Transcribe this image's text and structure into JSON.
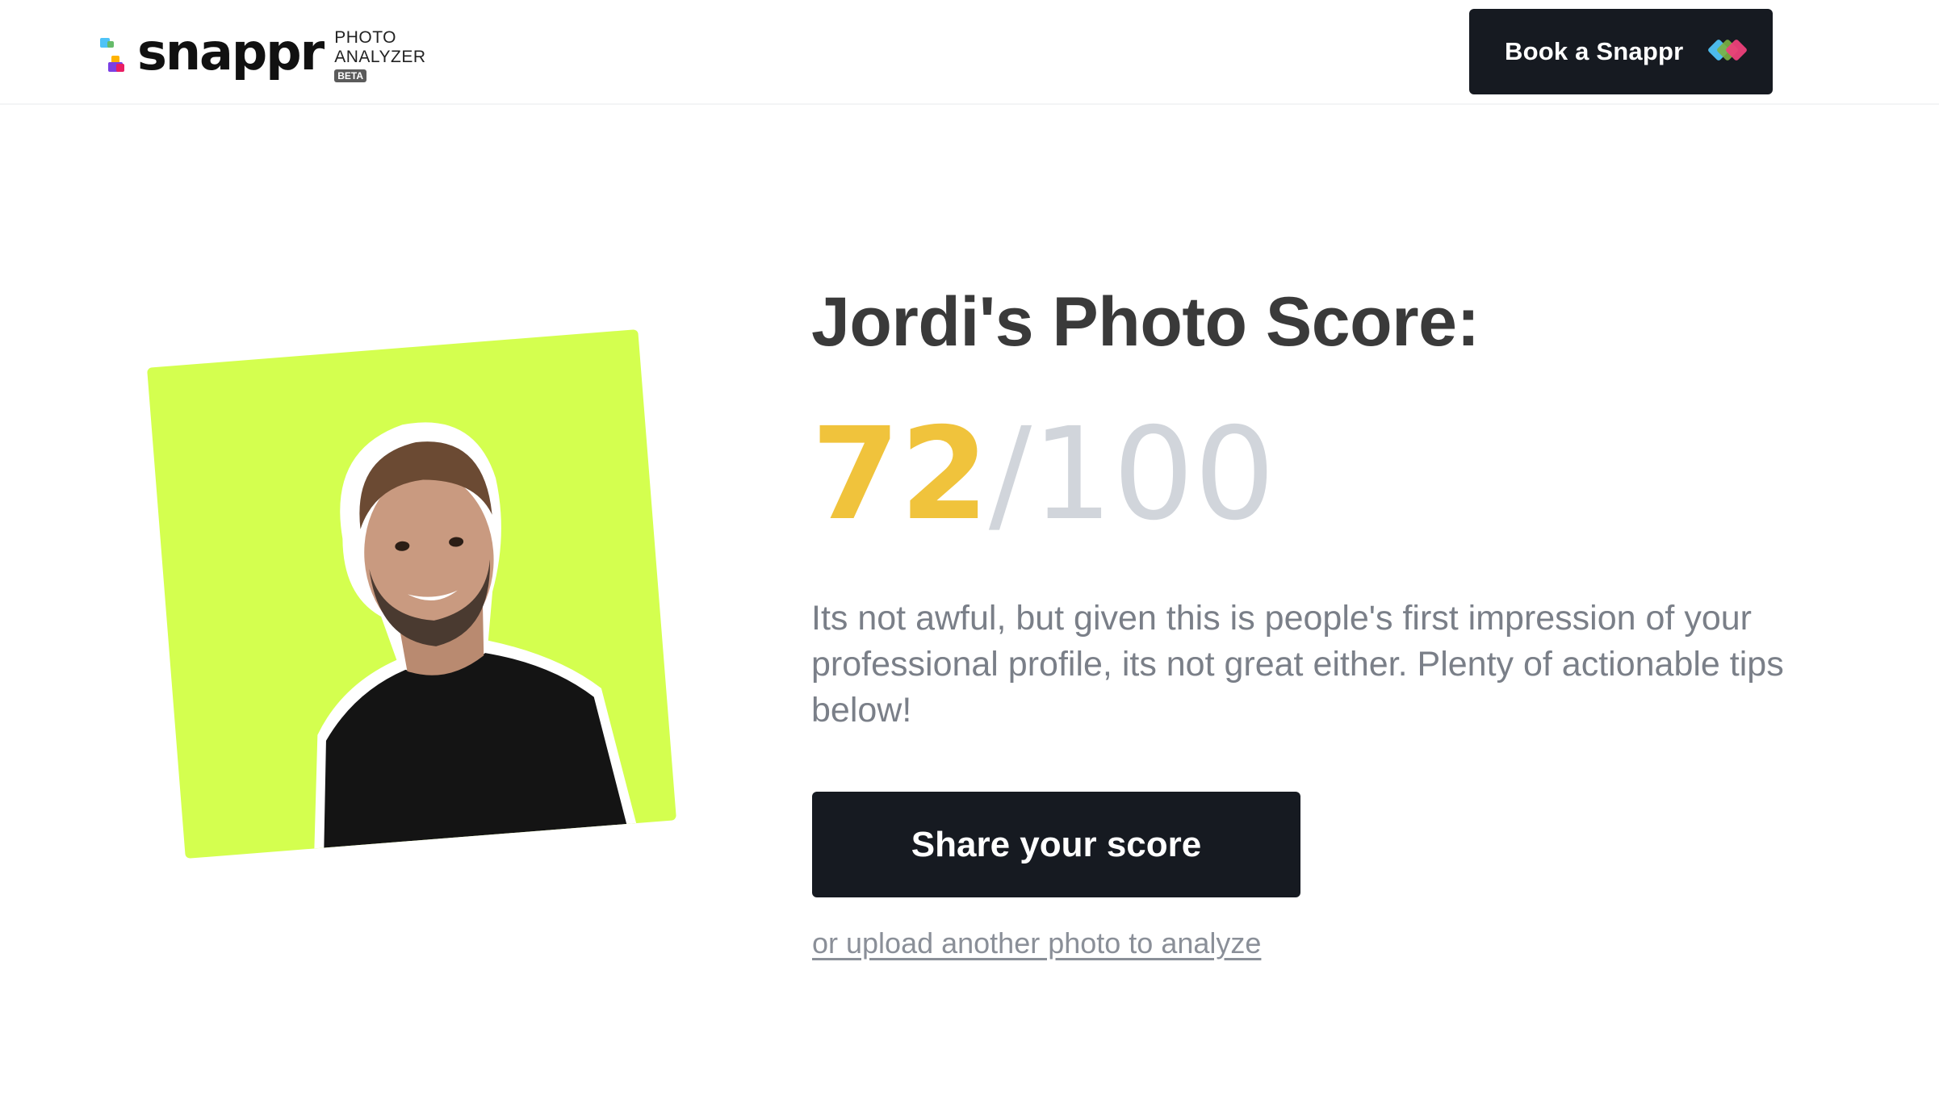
{
  "header": {
    "logo": {
      "wordmark": "snappr",
      "sub_line1": "PHOTO",
      "sub_line2": "ANALYZER",
      "badge": "BETA"
    },
    "book_button": {
      "label": "Book a Snappr",
      "icon": "snappr-arrows-icon"
    }
  },
  "main": {
    "photo": {
      "icon": "profile-photo",
      "background_color": "#d4ff4f"
    },
    "title": "Jordi's Photo Score:",
    "score": {
      "value": "72",
      "separator": "/",
      "max": "100",
      "value_color": "#f0c33c",
      "max_color": "#d1d5db"
    },
    "description": "Its not awful, but given this is people's first impression of your professional profile, its not great either. Plenty of actionable tips below!",
    "share_button": {
      "label": "Share your score"
    },
    "upload_link": {
      "label": "or upload another photo to analyze"
    }
  },
  "colors": {
    "button_bg": "#161a21",
    "text_dark": "#3a3a3a",
    "text_muted": "#7a7f88"
  }
}
